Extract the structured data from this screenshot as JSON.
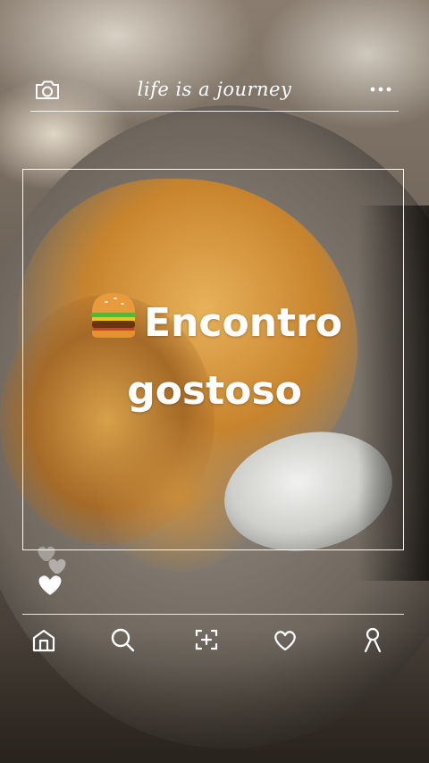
{
  "header": {
    "tagline": "life is a journey",
    "left_icon": "camera-icon",
    "right_icon": "more-dots-icon"
  },
  "post": {
    "headline_line1": "Encontro",
    "headline_line2": "gostoso",
    "headline_emoji": "burger-icon"
  },
  "reactions": {
    "icon": "heart-icon"
  },
  "bottom_nav": {
    "items": [
      {
        "icon": "home-icon"
      },
      {
        "icon": "search-icon"
      },
      {
        "icon": "add-post-icon"
      },
      {
        "icon": "heart-icon"
      },
      {
        "icon": "profile-icon"
      }
    ]
  },
  "colors": {
    "overlay": "#ffffff"
  }
}
